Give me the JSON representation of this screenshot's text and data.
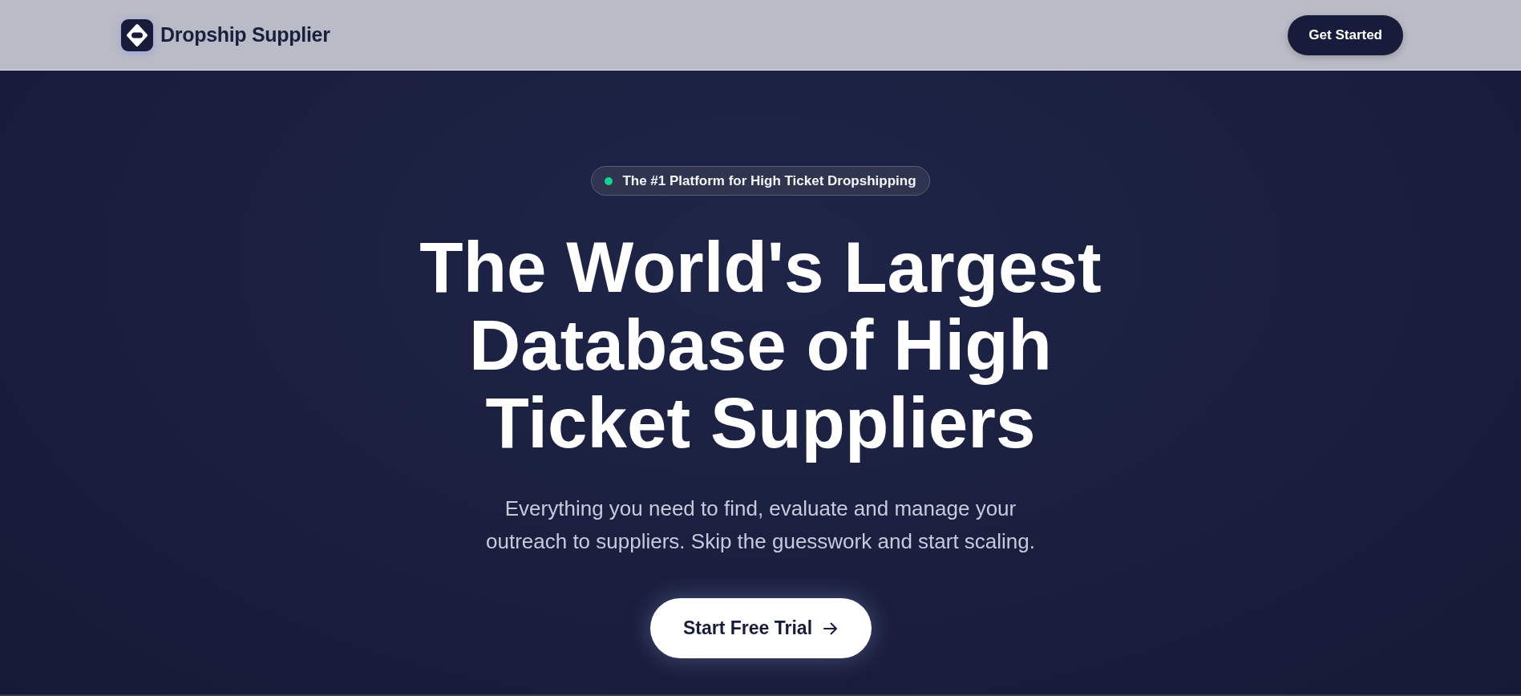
{
  "header": {
    "brand": "Dropship Supplier",
    "button": "Get Started"
  },
  "hero": {
    "badge": "The #1 Platform for High Ticket Dropshipping",
    "headline": "The World's Largest Database of High Ticket Suppliers",
    "subtitle": "Everything you need to find, evaluate and manage your outreach to suppliers. Skip the guesswork and start scaling.",
    "cta": "Start Free Trial"
  }
}
